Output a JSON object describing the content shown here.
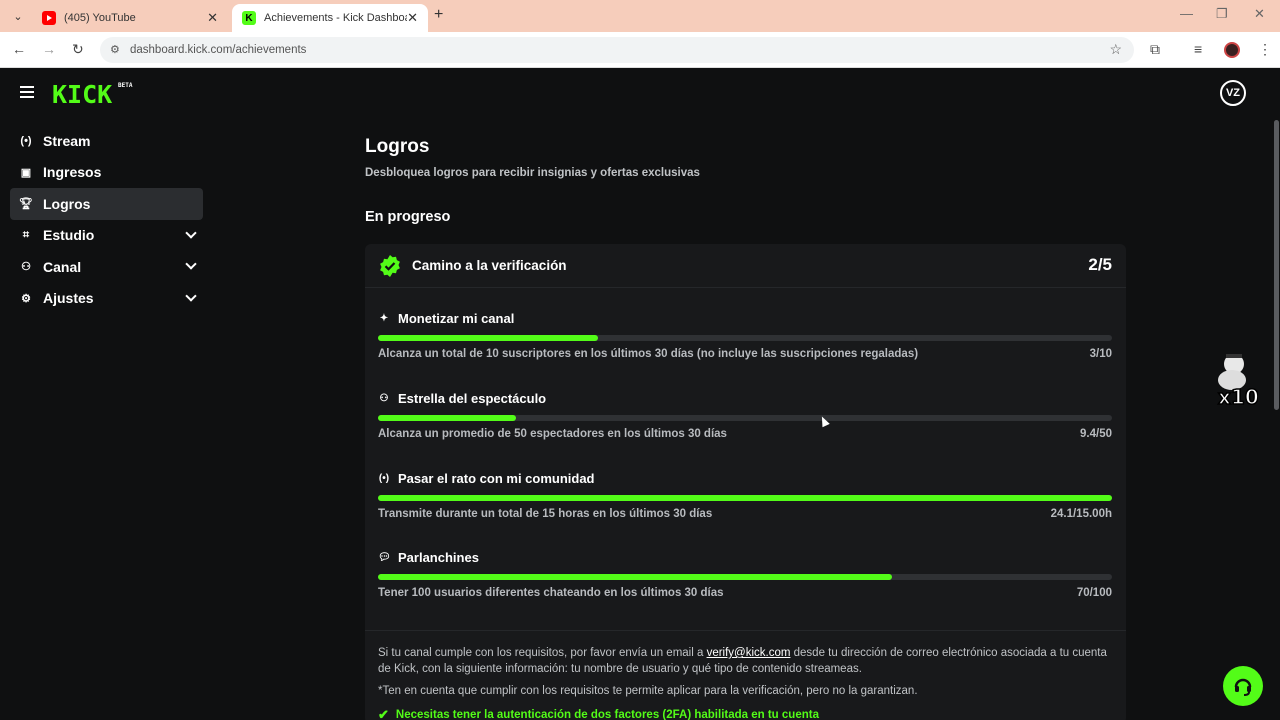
{
  "browser": {
    "tabs": [
      {
        "title": "(405) YouTube",
        "active": false
      },
      {
        "title": "Achievements - Kick Dashboard",
        "active": true
      }
    ],
    "url": "dashboard.kick.com/achievements"
  },
  "app": {
    "logo": "KICK",
    "logo_badge": "BETA",
    "avatar_initials": "VZ",
    "accent_color": "#53fc18"
  },
  "sidebar": {
    "items": [
      {
        "label": "Stream",
        "icon": "broadcast-icon",
        "expandable": false,
        "active": false
      },
      {
        "label": "Ingresos",
        "icon": "chart-icon",
        "expandable": false,
        "active": false
      },
      {
        "label": "Logros",
        "icon": "trophy-icon",
        "expandable": false,
        "active": true
      },
      {
        "label": "Estudio",
        "icon": "studio-icon",
        "expandable": true,
        "active": false
      },
      {
        "label": "Canal",
        "icon": "channel-icon",
        "expandable": true,
        "active": false
      },
      {
        "label": "Ajustes",
        "icon": "gear-icon",
        "expandable": true,
        "active": false
      }
    ]
  },
  "page": {
    "title": "Logros",
    "subtitle": "Desbloquea logros para recibir insignias y ofertas exclusivas",
    "section": "En progreso"
  },
  "achievement": {
    "title": "Camino a la verificación",
    "count": "2/5",
    "goals": [
      {
        "title": "Monetizar mi canal",
        "icon": "sparkle-icon",
        "description": "Alcanza un total de 10 suscriptores en los últimos 30 días (no incluye las suscripciones regaladas)",
        "value": "3/10",
        "progress": 0.3
      },
      {
        "title": "Estrella del espectáculo",
        "icon": "users-icon",
        "description": "Alcanza un promedio de 50 espectadores en los últimos 30 días",
        "value": "9.4/50",
        "progress": 0.188
      },
      {
        "title": "Pasar el rato con mi comunidad",
        "icon": "broadcast-icon",
        "description": "Transmite durante un total de 15 horas en los últimos 30 días",
        "value": "24.1/15.00h",
        "progress": 1.0
      },
      {
        "title": "Parlanchines",
        "icon": "chat-icon",
        "description": "Tener 100 usuarios diferentes chateando en los últimos 30 días",
        "value": "70/100",
        "progress": 0.7
      }
    ],
    "info": {
      "line1_a": "Si tu canal cumple con los requisitos, por favor envía un email a ",
      "email": "verify@kick.com",
      "line1_b": " desde tu dirección de correo electrónico asociada a tu cuenta de Kick, con la siguiente información: tu nombre de usuario y qué tipo de contenido streameas.",
      "note": "*Ten en cuenta que cumplir con los requisitos te permite aplicar para la verificación, pero no la garantizan.",
      "requirement": "Necesitas tener la autenticación de dos factores (2FA) habilitada en tu cuenta"
    }
  }
}
